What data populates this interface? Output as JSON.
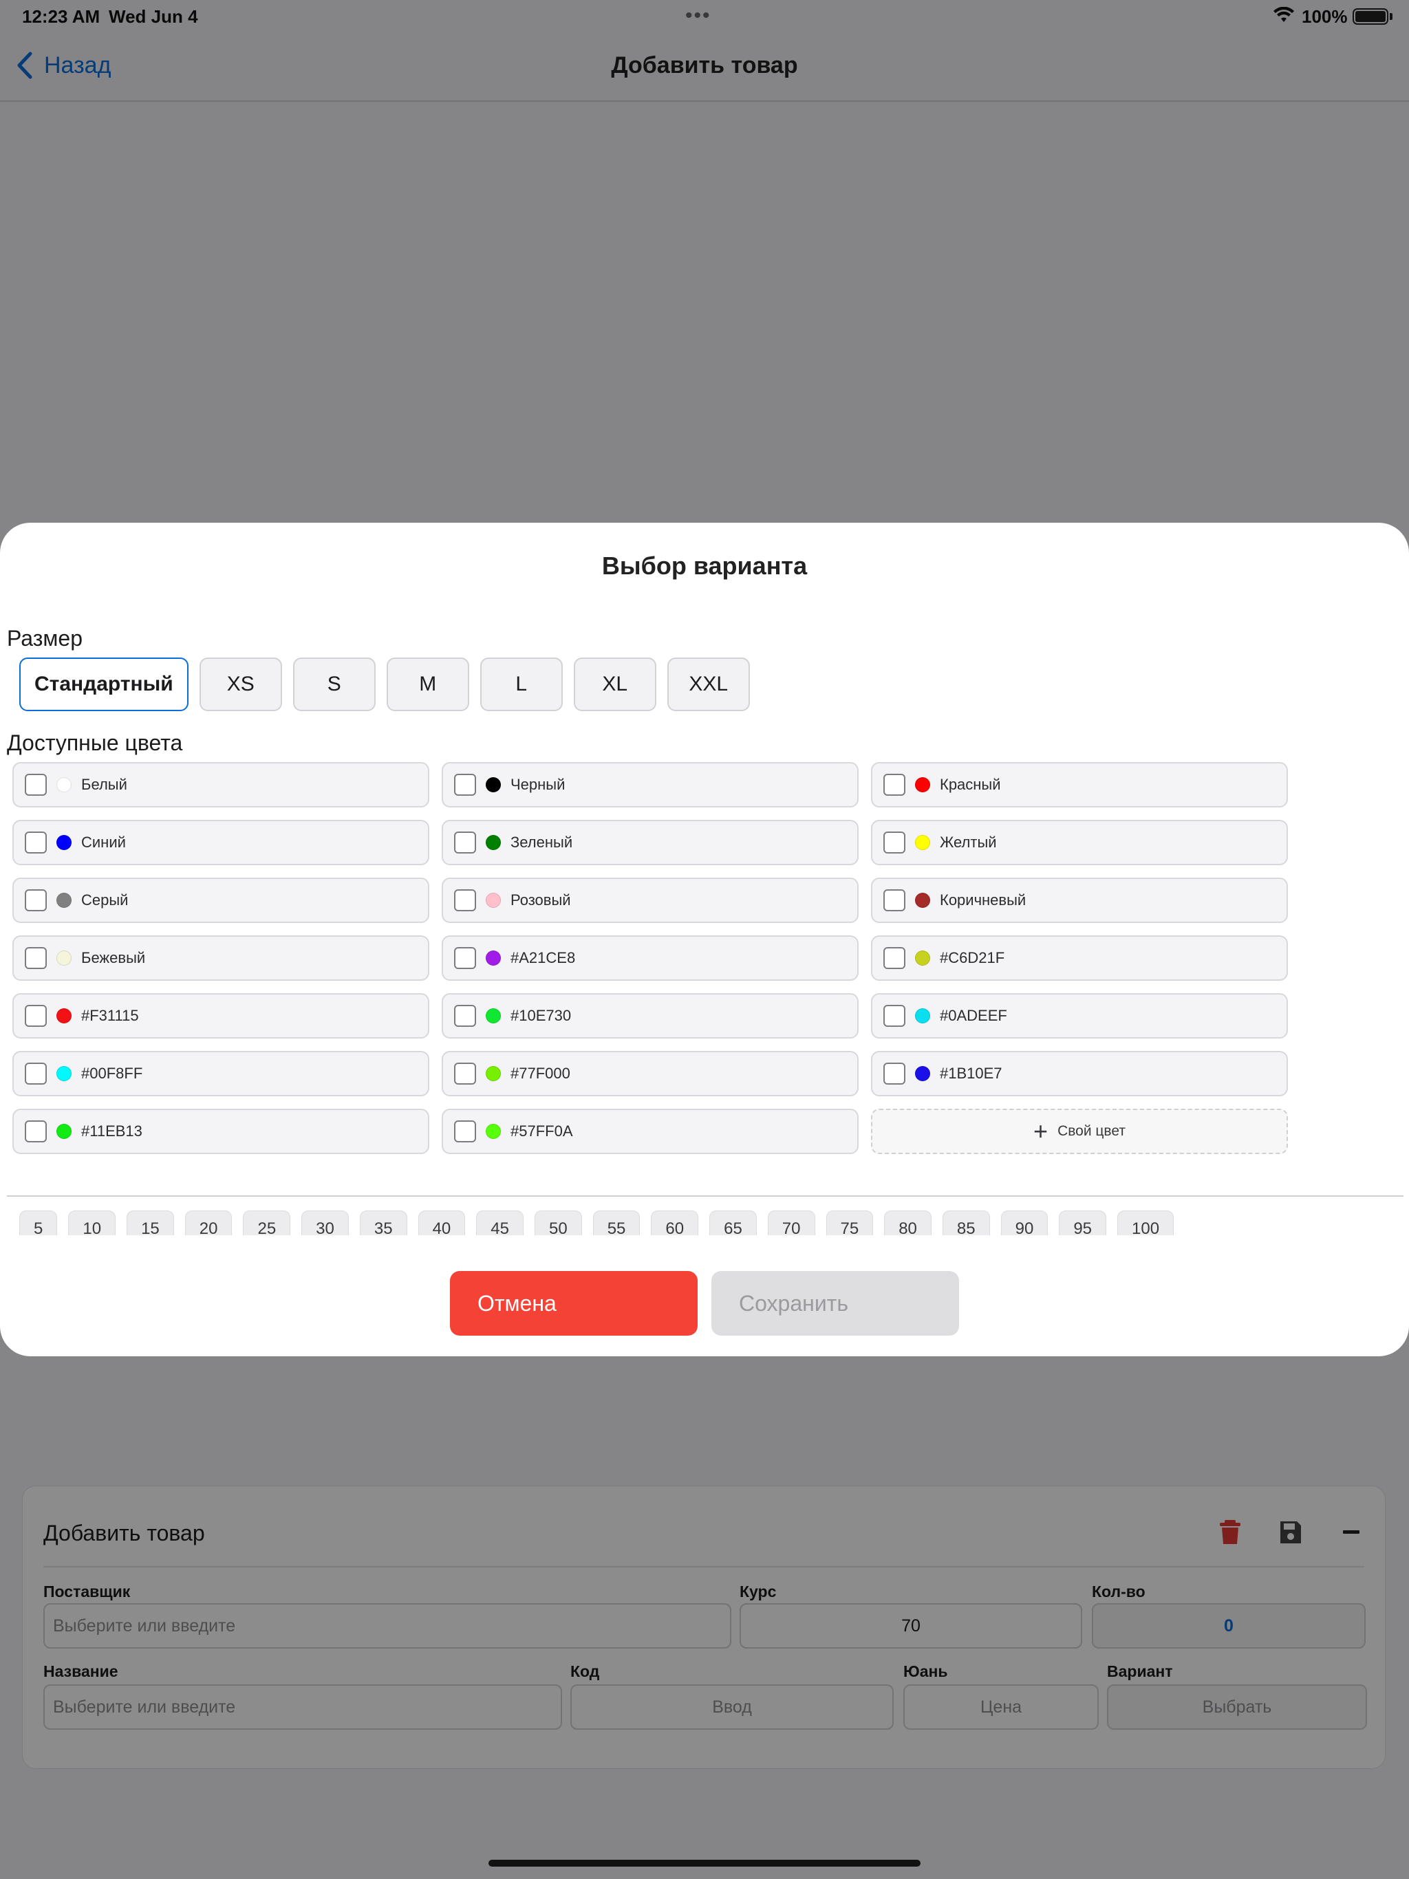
{
  "status_bar": {
    "time": "12:23 AM",
    "date": "Wed Jun 4",
    "battery": "100%"
  },
  "nav": {
    "back_label": "Назад",
    "title": "Добавить товар"
  },
  "form": {
    "title": "Добавить товар",
    "supplier_label": "Поставщик",
    "supplier_placeholder": "Выберите или введите",
    "rate_label": "Курс",
    "rate_value": "70",
    "qty_label": "Кол-во",
    "qty_value": "0",
    "name_label": "Название",
    "name_placeholder": "Выберите или введите",
    "code_label": "Код",
    "code_placeholder": "Ввод",
    "yuan_label": "Юань",
    "yuan_placeholder": "Цена",
    "variant_label": "Вариант",
    "variant_button": "Выбрать"
  },
  "modal": {
    "title": "Выбор варианта",
    "size_label": "Размер",
    "sizes": [
      "Стандартный",
      "XS",
      "S",
      "M",
      "L",
      "XL",
      "XXL"
    ],
    "selected_size": "Стандартный",
    "colors_label": "Доступные цвета",
    "colors": [
      {
        "name": "Белый",
        "hex": "#FFFFFF"
      },
      {
        "name": "Черный",
        "hex": "#000000"
      },
      {
        "name": "Красный",
        "hex": "#FF0000"
      },
      {
        "name": "Синий",
        "hex": "#0000FF"
      },
      {
        "name": "Зеленый",
        "hex": "#008000"
      },
      {
        "name": "Желтый",
        "hex": "#FFFF00"
      },
      {
        "name": "Серый",
        "hex": "#808080"
      },
      {
        "name": "Розовый",
        "hex": "#FFC0CB"
      },
      {
        "name": "Коричневый",
        "hex": "#A52A2A"
      },
      {
        "name": "Бежевый",
        "hex": "#F5F5DC"
      },
      {
        "name": "#A21CE8",
        "hex": "#A21CE8"
      },
      {
        "name": "#C6D21F",
        "hex": "#C6D21F"
      },
      {
        "name": "#F31115",
        "hex": "#F31115"
      },
      {
        "name": "#10E730",
        "hex": "#10E730"
      },
      {
        "name": "#0ADEEF",
        "hex": "#0ADEEF"
      },
      {
        "name": "#00F8FF",
        "hex": "#00F8FF"
      },
      {
        "name": "#77F000",
        "hex": "#77F000"
      },
      {
        "name": "#1B10E7",
        "hex": "#1B10E7"
      },
      {
        "name": "#11EB13",
        "hex": "#11EB13"
      },
      {
        "name": "#57FF0A",
        "hex": "#57FF0A"
      }
    ],
    "custom_color_label": "Свой цвет",
    "quantities": [
      "5",
      "10",
      "15",
      "20",
      "25",
      "30",
      "35",
      "40",
      "45",
      "50",
      "55",
      "60",
      "65",
      "70",
      "75",
      "80",
      "85",
      "90",
      "95",
      "100"
    ],
    "cancel_label": "Отмена",
    "save_label": "Сохранить"
  },
  "theme": {
    "accent": "#0A6DD9",
    "danger": "#F44336"
  }
}
